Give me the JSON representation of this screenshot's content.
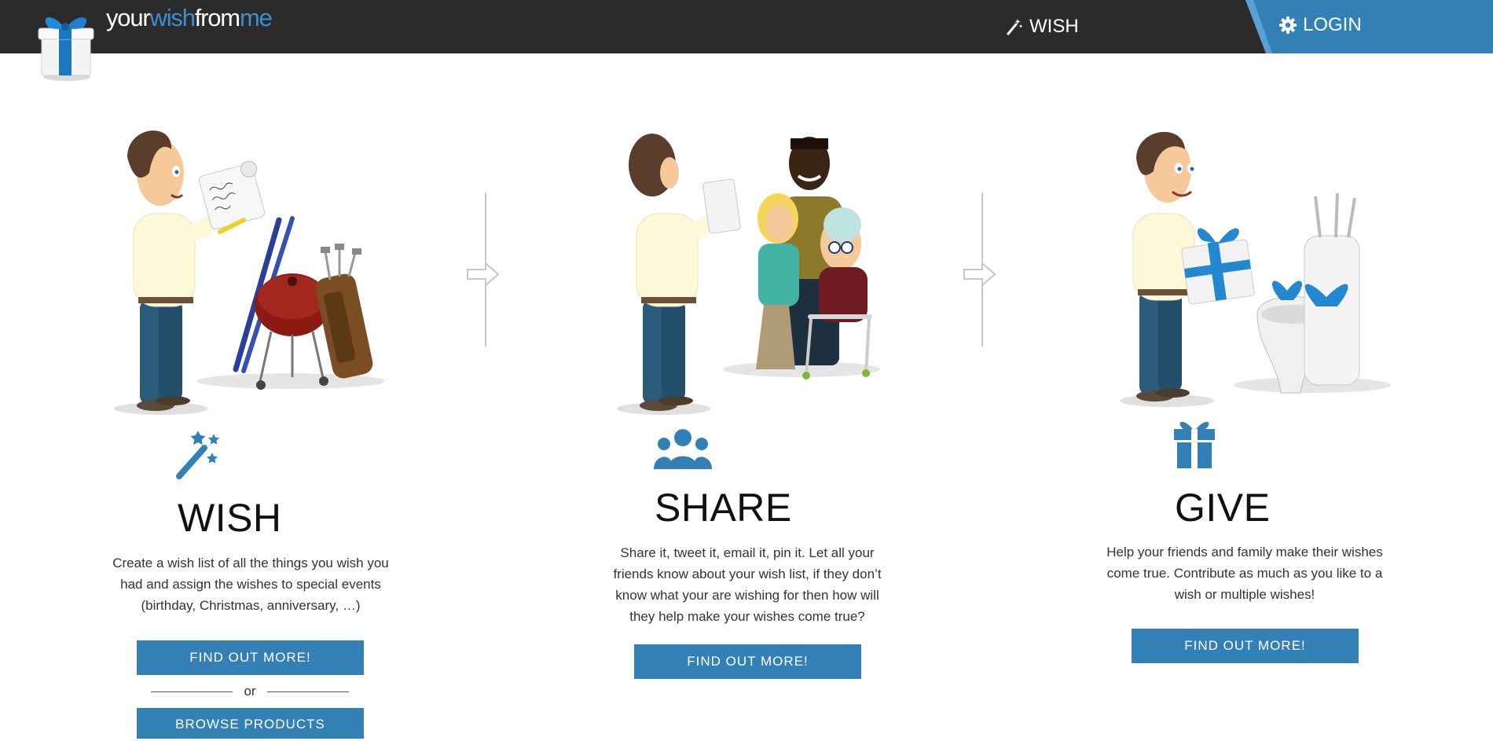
{
  "header": {
    "brand": {
      "part1": "your",
      "part2": "wish",
      "part3": "from",
      "part4": "me"
    },
    "nav_wish_label": "WISH",
    "login_label": "LOGIN",
    "colors": {
      "bar": "#2b2b2b",
      "accent": "#3380b6",
      "brand_blue": "#3b8fd0"
    }
  },
  "features": [
    {
      "icon": "magic-wand-icon",
      "title": "WISH",
      "lines": [
        "Create a wish list of all the things you wish you",
        "had and assign the wishes to special events",
        "(birthday, Christmas, anniversary, …)"
      ],
      "button": "FIND OUT MORE!"
    },
    {
      "icon": "users-icon",
      "title": "SHARE",
      "lines": [
        "Share it, tweet it, email it, pin it. Let all your",
        "friends know about your wish list, if they don’t",
        "know what your are wishing for then how will",
        "they help make your wishes come true?"
      ],
      "button": "FIND OUT MORE!"
    },
    {
      "icon": "gift-icon",
      "title": "GIVE",
      "lines": [
        "Help your friends and family make their wishes",
        "come true. Contribute as much as you like to a",
        "wish or multiple wishes!"
      ],
      "button": "FIND OUT MORE!"
    }
  ],
  "or_label": "or",
  "browse_button": "BROWSE PRODUCTS"
}
